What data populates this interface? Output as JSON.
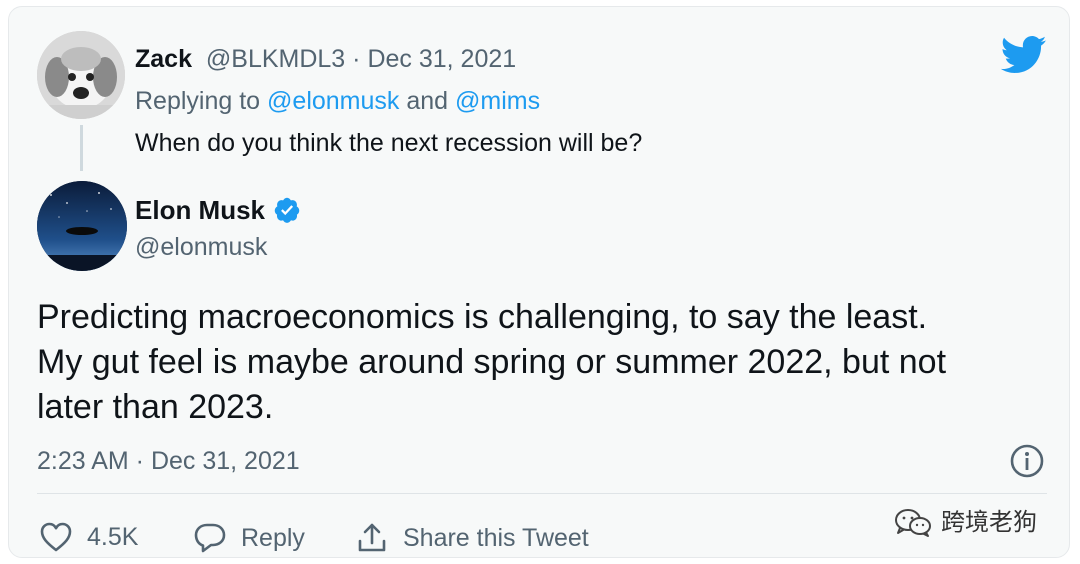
{
  "reply": {
    "name": "Zack",
    "handle": "@BLKMDL3",
    "separator": " · ",
    "date": "Dec 31, 2021",
    "replying_prefix": "Replying to ",
    "replying_to_1": "@elonmusk",
    "replying_and": " and ",
    "replying_to_2": "@mims",
    "text": "When do you think the next recession will be?"
  },
  "tweet": {
    "name": "Elon Musk",
    "handle": "@elonmusk",
    "body_lines": [
      "Predicting macroeconomics is challenging, to say the least.",
      "My gut feel is maybe around spring or summer 2022, but not",
      "later than 2023."
    ],
    "timestamp": "2:23 AM · Dec 31, 2021"
  },
  "actions": {
    "like_count": "4.5K",
    "reply_label": "Reply",
    "share_label": "Share this Tweet"
  },
  "watermark": {
    "text": "跨境老狗"
  },
  "icons": {
    "brand": "twitter-bird-icon",
    "verified": "verified-badge-icon",
    "info": "info-icon",
    "like": "heart-icon",
    "reply": "speech-bubble-icon",
    "share": "share-upload-icon",
    "watermark": "wechat-icon"
  },
  "colors": {
    "card_background": "#f7f9f9",
    "text_primary": "#0f1419",
    "text_muted": "#536471",
    "accent": "#1d9bf0"
  }
}
